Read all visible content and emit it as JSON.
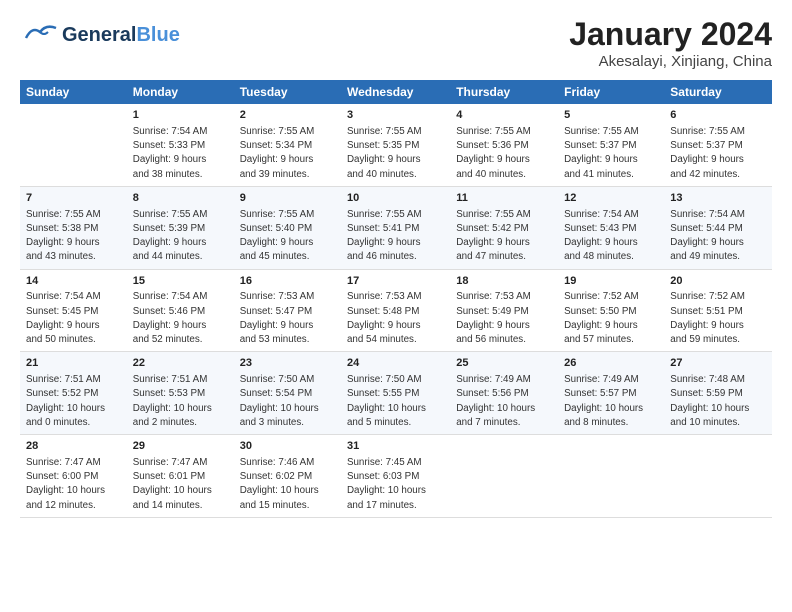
{
  "header": {
    "logo_line1": "General",
    "logo_line2": "Blue",
    "month": "January 2024",
    "location": "Akesalayi, Xinjiang, China"
  },
  "days_of_week": [
    "Sunday",
    "Monday",
    "Tuesday",
    "Wednesday",
    "Thursday",
    "Friday",
    "Saturday"
  ],
  "weeks": [
    [
      {
        "num": "",
        "info": ""
      },
      {
        "num": "1",
        "info": "Sunrise: 7:54 AM\nSunset: 5:33 PM\nDaylight: 9 hours\nand 38 minutes."
      },
      {
        "num": "2",
        "info": "Sunrise: 7:55 AM\nSunset: 5:34 PM\nDaylight: 9 hours\nand 39 minutes."
      },
      {
        "num": "3",
        "info": "Sunrise: 7:55 AM\nSunset: 5:35 PM\nDaylight: 9 hours\nand 40 minutes."
      },
      {
        "num": "4",
        "info": "Sunrise: 7:55 AM\nSunset: 5:36 PM\nDaylight: 9 hours\nand 40 minutes."
      },
      {
        "num": "5",
        "info": "Sunrise: 7:55 AM\nSunset: 5:37 PM\nDaylight: 9 hours\nand 41 minutes."
      },
      {
        "num": "6",
        "info": "Sunrise: 7:55 AM\nSunset: 5:37 PM\nDaylight: 9 hours\nand 42 minutes."
      }
    ],
    [
      {
        "num": "7",
        "info": "Sunrise: 7:55 AM\nSunset: 5:38 PM\nDaylight: 9 hours\nand 43 minutes."
      },
      {
        "num": "8",
        "info": "Sunrise: 7:55 AM\nSunset: 5:39 PM\nDaylight: 9 hours\nand 44 minutes."
      },
      {
        "num": "9",
        "info": "Sunrise: 7:55 AM\nSunset: 5:40 PM\nDaylight: 9 hours\nand 45 minutes."
      },
      {
        "num": "10",
        "info": "Sunrise: 7:55 AM\nSunset: 5:41 PM\nDaylight: 9 hours\nand 46 minutes."
      },
      {
        "num": "11",
        "info": "Sunrise: 7:55 AM\nSunset: 5:42 PM\nDaylight: 9 hours\nand 47 minutes."
      },
      {
        "num": "12",
        "info": "Sunrise: 7:54 AM\nSunset: 5:43 PM\nDaylight: 9 hours\nand 48 minutes."
      },
      {
        "num": "13",
        "info": "Sunrise: 7:54 AM\nSunset: 5:44 PM\nDaylight: 9 hours\nand 49 minutes."
      }
    ],
    [
      {
        "num": "14",
        "info": "Sunrise: 7:54 AM\nSunset: 5:45 PM\nDaylight: 9 hours\nand 50 minutes."
      },
      {
        "num": "15",
        "info": "Sunrise: 7:54 AM\nSunset: 5:46 PM\nDaylight: 9 hours\nand 52 minutes."
      },
      {
        "num": "16",
        "info": "Sunrise: 7:53 AM\nSunset: 5:47 PM\nDaylight: 9 hours\nand 53 minutes."
      },
      {
        "num": "17",
        "info": "Sunrise: 7:53 AM\nSunset: 5:48 PM\nDaylight: 9 hours\nand 54 minutes."
      },
      {
        "num": "18",
        "info": "Sunrise: 7:53 AM\nSunset: 5:49 PM\nDaylight: 9 hours\nand 56 minutes."
      },
      {
        "num": "19",
        "info": "Sunrise: 7:52 AM\nSunset: 5:50 PM\nDaylight: 9 hours\nand 57 minutes."
      },
      {
        "num": "20",
        "info": "Sunrise: 7:52 AM\nSunset: 5:51 PM\nDaylight: 9 hours\nand 59 minutes."
      }
    ],
    [
      {
        "num": "21",
        "info": "Sunrise: 7:51 AM\nSunset: 5:52 PM\nDaylight: 10 hours\nand 0 minutes."
      },
      {
        "num": "22",
        "info": "Sunrise: 7:51 AM\nSunset: 5:53 PM\nDaylight: 10 hours\nand 2 minutes."
      },
      {
        "num": "23",
        "info": "Sunrise: 7:50 AM\nSunset: 5:54 PM\nDaylight: 10 hours\nand 3 minutes."
      },
      {
        "num": "24",
        "info": "Sunrise: 7:50 AM\nSunset: 5:55 PM\nDaylight: 10 hours\nand 5 minutes."
      },
      {
        "num": "25",
        "info": "Sunrise: 7:49 AM\nSunset: 5:56 PM\nDaylight: 10 hours\nand 7 minutes."
      },
      {
        "num": "26",
        "info": "Sunrise: 7:49 AM\nSunset: 5:57 PM\nDaylight: 10 hours\nand 8 minutes."
      },
      {
        "num": "27",
        "info": "Sunrise: 7:48 AM\nSunset: 5:59 PM\nDaylight: 10 hours\nand 10 minutes."
      }
    ],
    [
      {
        "num": "28",
        "info": "Sunrise: 7:47 AM\nSunset: 6:00 PM\nDaylight: 10 hours\nand 12 minutes."
      },
      {
        "num": "29",
        "info": "Sunrise: 7:47 AM\nSunset: 6:01 PM\nDaylight: 10 hours\nand 14 minutes."
      },
      {
        "num": "30",
        "info": "Sunrise: 7:46 AM\nSunset: 6:02 PM\nDaylight: 10 hours\nand 15 minutes."
      },
      {
        "num": "31",
        "info": "Sunrise: 7:45 AM\nSunset: 6:03 PM\nDaylight: 10 hours\nand 17 minutes."
      },
      {
        "num": "",
        "info": ""
      },
      {
        "num": "",
        "info": ""
      },
      {
        "num": "",
        "info": ""
      }
    ]
  ]
}
